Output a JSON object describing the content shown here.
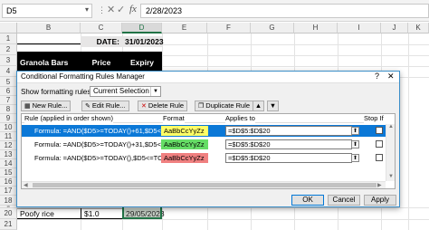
{
  "formula_bar": {
    "name_box": "D5",
    "formula": "2/28/2023"
  },
  "columns": [
    "B",
    "C",
    "D",
    "E",
    "F",
    "G",
    "H",
    "I",
    "J",
    "K"
  ],
  "rows": [
    "1",
    "2",
    "3",
    "4",
    "5",
    "6",
    "7",
    "8",
    "9",
    "10",
    "11",
    "12",
    "13",
    "14",
    "15",
    "16",
    "17",
    "18",
    "19",
    "20",
    "21"
  ],
  "sheet": {
    "date_label": "DATE:",
    "date_value": "31/01/2023",
    "header_product": "Granola Bars",
    "header_price": "Price",
    "header_expiry": "Expiry",
    "row20_product": "Poofy rice",
    "row20_price": "$1.0",
    "row20_expiry": "29/05/2023"
  },
  "dialog": {
    "title": "Conditional Formatting Rules Manager",
    "help_glyph": "?",
    "close_glyph": "✕",
    "show_label": "Show formatting rules for:",
    "show_value": "Current Selection",
    "buttons": {
      "new_rule": "New Rule...",
      "edit_rule": "Edit Rule...",
      "delete_rule": "Delete Rule",
      "duplicate_rule": "Duplicate Rule"
    },
    "table_headers": {
      "rule": "Rule (applied in order shown)",
      "format": "Format",
      "applies_to": "Applies to",
      "stop_if_true": "Stop If True"
    },
    "rules": [
      {
        "rule": "Formula: =AND($D5>=TODAY()+61,$D5<=TODAY()...",
        "format_preview": "AaBbCcYyZz",
        "format_color": "#ffff66",
        "applies_to": "=$D$5:$D$20",
        "selected": true
      },
      {
        "rule": "Formula: =AND($D5>=TODAY()+31,$D5<=TODAY()...",
        "format_preview": "AaBbCcYyZz",
        "format_color": "#66dd66",
        "applies_to": "=$D$5:$D$20",
        "selected": false
      },
      {
        "rule": "Formula: =AND($D5>=TODAY(),$D5<=TODAY()+30)",
        "format_preview": "AaBbCcYyZz",
        "format_color": "#f08080",
        "applies_to": "=$D$5:$D$20",
        "selected": false
      }
    ],
    "ok_label": "OK",
    "cancel_label": "Cancel",
    "apply_label": "Apply"
  }
}
